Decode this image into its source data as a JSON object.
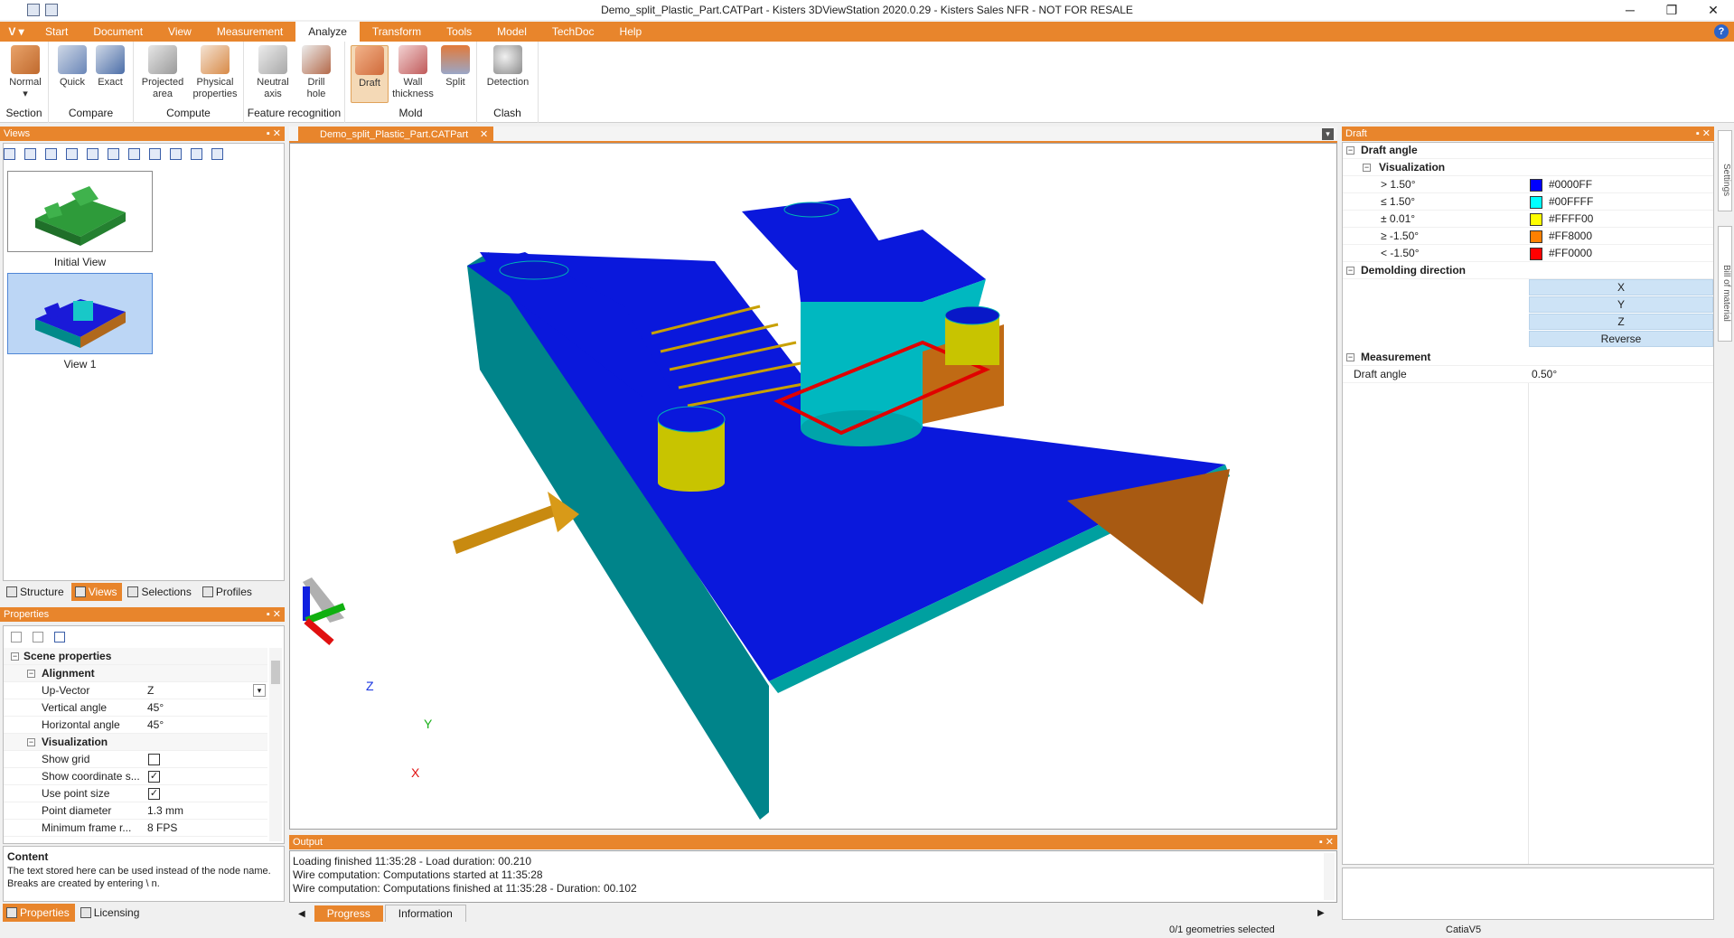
{
  "window": {
    "title": "Demo_split_Plastic_Part.CATPart - Kisters 3DViewStation 2020.0.29 - Kisters Sales NFR - NOT FOR RESALE",
    "minimize": "─",
    "restore": "❐",
    "close": "✕"
  },
  "menu": {
    "logo": "V ▾",
    "tabs": [
      "Start",
      "Document",
      "View",
      "Measurement",
      "Analyze",
      "Transform",
      "Tools",
      "Model",
      "TechDoc",
      "Help"
    ],
    "active": "Analyze",
    "help_glyph": "?"
  },
  "ribbon": {
    "section": {
      "label": "Section",
      "buttons": [
        {
          "label": "Normal",
          "sub": "▾"
        }
      ]
    },
    "compare": {
      "label": "Compare",
      "buttons": [
        {
          "label": "Quick"
        },
        {
          "label": "Exact"
        }
      ]
    },
    "compute": {
      "label": "Compute",
      "buttons": [
        {
          "label": "Projected\narea"
        },
        {
          "label": "Physical\nproperties"
        }
      ]
    },
    "feature": {
      "label": "Feature recognition",
      "buttons": [
        {
          "label": "Neutral\naxis"
        },
        {
          "label": "Drill\nhole"
        }
      ]
    },
    "mold": {
      "label": "Mold",
      "buttons": [
        {
          "label": "Draft"
        },
        {
          "label": "Wall\nthickness"
        },
        {
          "label": "Split"
        }
      ]
    },
    "clash": {
      "label": "Clash",
      "buttons": [
        {
          "label": "Detection"
        }
      ]
    }
  },
  "views_panel": {
    "title": "Views",
    "items": [
      {
        "label": "Initial View"
      },
      {
        "label": "View 1"
      }
    ],
    "tabs": [
      "Structure",
      "Views",
      "Selections",
      "Profiles"
    ],
    "active_tab": "Views"
  },
  "properties_panel": {
    "title": "Properties",
    "scene": "Scene properties",
    "alignment": "Alignment",
    "up_vector": {
      "label": "Up-Vector",
      "value": "Z"
    },
    "vertical_angle": {
      "label": "Vertical angle",
      "value": "45°"
    },
    "horizontal_angle": {
      "label": "Horizontal angle",
      "value": "45°"
    },
    "visualization": "Visualization",
    "show_grid": {
      "label": "Show grid",
      "checked": false
    },
    "show_coord": {
      "label": "Show coordinate s...",
      "checked": true
    },
    "use_point_size": {
      "label": "Use point size",
      "checked": true
    },
    "point_diameter": {
      "label": "Point diameter",
      "value": "1.3 mm"
    },
    "min_frame": {
      "label": "Minimum frame r...",
      "value": "8 FPS"
    },
    "content_title": "Content",
    "content_text": "The text stored here can be used instead of the node name. Breaks are created by entering \\ n.",
    "tabs": [
      "Properties",
      "Licensing"
    ],
    "active_tab": "Properties"
  },
  "document_tab": "Demo_split_Plastic_Part.CATPart",
  "axis_labels": {
    "x": "X",
    "y": "Y",
    "z": "Z"
  },
  "output_panel": {
    "title": "Output",
    "lines": [
      "Loading finished 11:35:28 - Load duration: 00.210",
      "Wire computation: Computations started at 11:35:28",
      "Wire computation: Computations finished at 11:35:28 - Duration: 00.102"
    ],
    "tabs": [
      "Progress",
      "Information"
    ],
    "active_tab": "Progress"
  },
  "draft_panel": {
    "title": "Draft",
    "draft_angle": "Draft angle",
    "visualization": "Visualization",
    "ranges": [
      {
        "label": "> 1.50°",
        "color": "#0000FF",
        "hex": "#0000FF"
      },
      {
        "label": "≤ 1.50°",
        "color": "#00FFFF",
        "hex": "#00FFFF"
      },
      {
        "label": "± 0.01°",
        "color": "#FFFF00",
        "hex": "#FFFF00"
      },
      {
        "label": "≥ -1.50°",
        "color": "#FF8000",
        "hex": "#FF8000"
      },
      {
        "label": "< -1.50°",
        "color": "#FF0000",
        "hex": "#FF0000"
      }
    ],
    "demolding": "Demolding direction",
    "dir_buttons": [
      "X",
      "Y",
      "Z",
      "Reverse"
    ],
    "measurement": "Measurement",
    "measured": {
      "label": "Draft angle",
      "value": "0.50°"
    }
  },
  "side_tabs": [
    "Settings",
    "Bill of material"
  ],
  "status": {
    "selection": "0/1 geometries selected",
    "format": "CatiaV5"
  }
}
